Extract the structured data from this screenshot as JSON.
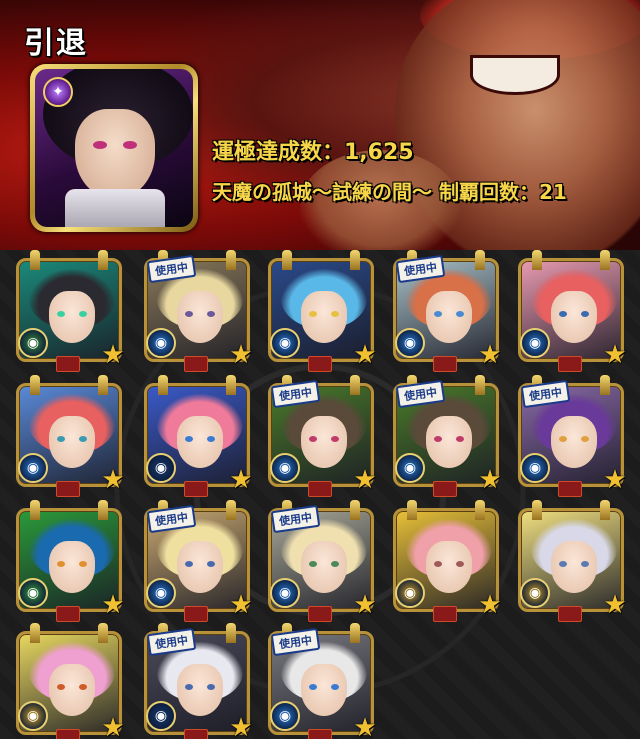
{
  "header": {
    "title": "引退",
    "stat_luck": "運極達成数：1,625",
    "stat_clear": "天魔の孤城〜試練の間〜 制覇回数：21",
    "avatar_badge_icon": "star-icon"
  },
  "grid": {
    "in_use_label": "使用中",
    "cards": [
      {
        "in_use": false,
        "hair": "#2a2a30",
        "bg": "#1a8a7a",
        "eye": "#3ad0a0",
        "elem": "#3a8a3a"
      },
      {
        "in_use": true,
        "hair": "#e8d8a0",
        "bg": "#8a7a5a",
        "eye": "#6a5a9a",
        "elem": "#2a7ad0"
      },
      {
        "in_use": false,
        "hair": "#5ab8e8",
        "bg": "#2a4a8a",
        "eye": "#e8c040",
        "elem": "#2a7ad0"
      },
      {
        "in_use": true,
        "hair": "#d87048",
        "bg": "#a8c0c8",
        "eye": "#4a8ad0",
        "elem": "#2a7ad0"
      },
      {
        "in_use": false,
        "hair": "#e86060",
        "bg": "#e89ab0",
        "eye": "#3a6ab0",
        "elem": "#2a7ad0"
      },
      {
        "in_use": false,
        "hair": "#e86060",
        "bg": "#5a8ad8",
        "eye": "#3a9ab0",
        "elem": "#2a7ad0"
      },
      {
        "in_use": false,
        "hair": "#f07a9a",
        "bg": "#3a5ac8",
        "eye": "#3a7ad0",
        "elem": "#1a3a6a"
      },
      {
        "in_use": true,
        "hair": "#5a4a3a",
        "bg": "#4a7a2a",
        "eye": "#c03a6a",
        "elem": "#2a7ad0"
      },
      {
        "in_use": true,
        "hair": "#5a4a3a",
        "bg": "#4a7a2a",
        "eye": "#c03a6a",
        "elem": "#2a7ad0"
      },
      {
        "in_use": true,
        "hair": "#6a3a9a",
        "bg": "#8a6aa8",
        "eye": "#e0a040",
        "elem": "#2a7ad0"
      },
      {
        "in_use": false,
        "hair": "#1a6ab0",
        "bg": "#2a9a3a",
        "eye": "#e09030",
        "elem": "#3a9a3a"
      },
      {
        "in_use": true,
        "hair": "#f0e0a0",
        "bg": "#c8a870",
        "eye": "#4a6ab0",
        "elem": "#2a7ad0"
      },
      {
        "in_use": true,
        "hair": "#f0e0b0",
        "bg": "#a8a898",
        "eye": "#4a8a5a",
        "elem": "#2a7ad0"
      },
      {
        "in_use": false,
        "hair": "#f0a0a8",
        "bg": "#e8c038",
        "eye": "#a05a5a",
        "elem": "#d0a020"
      },
      {
        "in_use": false,
        "hair": "#d8d8e8",
        "bg": "#f0e080",
        "eye": "#5a7ab0",
        "elem": "#d0a020"
      },
      {
        "in_use": false,
        "hair": "#f0a0d0",
        "bg": "#e8d860",
        "eye": "#d05a2a",
        "elem": "#d0a020"
      },
      {
        "in_use": true,
        "hair": "#e8e8f0",
        "bg": "#4a4a5a",
        "eye": "#4a6ab0",
        "elem": "#1a3a6a"
      },
      {
        "in_use": true,
        "hair": "#e8e8e8",
        "bg": "#7a7a80",
        "eye": "#3a7ad0",
        "elem": "#2a7ad0"
      }
    ]
  }
}
